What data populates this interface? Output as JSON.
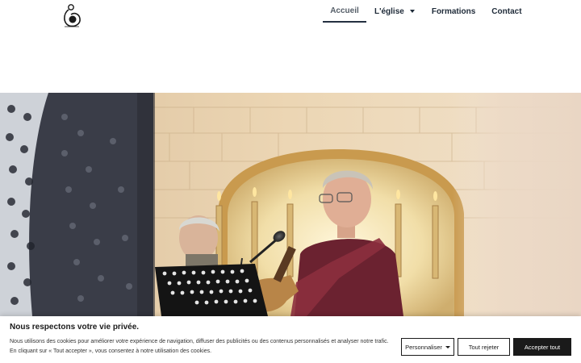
{
  "header": {
    "logo_alt": "logo",
    "nav": {
      "home": "Accueil",
      "church": "L'église",
      "trainings": "Formations",
      "contact": "Contact"
    }
  },
  "hero": {
    "image": "photo-musicians-in-church"
  },
  "cookie_banner": {
    "title": "Nous respectons votre vie privée.",
    "line1": "Nous utilisons des cookies pour améliorer votre expérience de navigation, diffuser des publicités ou des contenus personnalisés et analyser notre trafic.",
    "line2": "En cliquant sur « Tout accepter », vous consentez à notre utilisation des cookies.",
    "customize_label": "Personnaliser",
    "reject_label": "Tout rejeter",
    "accept_label": "Accepter tout"
  },
  "colors": {
    "nav_text": "#1e2a38",
    "nav_active_underline": "#243041",
    "banner_button_dark": "#1a1a1a"
  }
}
